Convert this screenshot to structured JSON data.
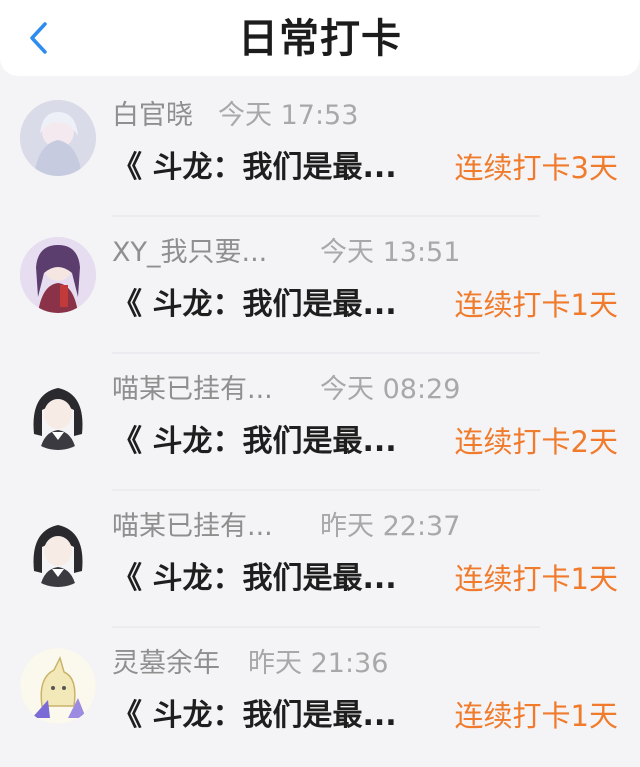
{
  "header": {
    "title": "日常打卡",
    "back_icon": "chevron-left-icon",
    "accent_color": "#2d8cf0"
  },
  "colors": {
    "streak": "#f07b2c",
    "name": "#8f8f8f",
    "book": "#1e1e1e"
  },
  "items": [
    {
      "name": "白官晓",
      "time": "今天 17:53",
      "book": "《 斗龙：我们是最...",
      "streak": "连续打卡3天",
      "avatar": "avatar-icon"
    },
    {
      "name": "XY_我只要...",
      "time": "今天 13:51",
      "book": "《 斗龙：我们是最...",
      "streak": "连续打卡1天",
      "avatar": "avatar-icon"
    },
    {
      "name": "喵某已挂有...",
      "time": "今天 08:29",
      "book": "《 斗龙：我们是最...",
      "streak": "连续打卡2天",
      "avatar": "avatar-icon"
    },
    {
      "name": "喵某已挂有...",
      "time": "昨天 22:37",
      "book": "《 斗龙：我们是最...",
      "streak": "连续打卡1天",
      "avatar": "avatar-icon"
    },
    {
      "name": "灵墓余年",
      "time": "昨天 21:36",
      "book": "《 斗龙：我们是最...",
      "streak": "连续打卡1天",
      "avatar": "avatar-icon"
    }
  ]
}
